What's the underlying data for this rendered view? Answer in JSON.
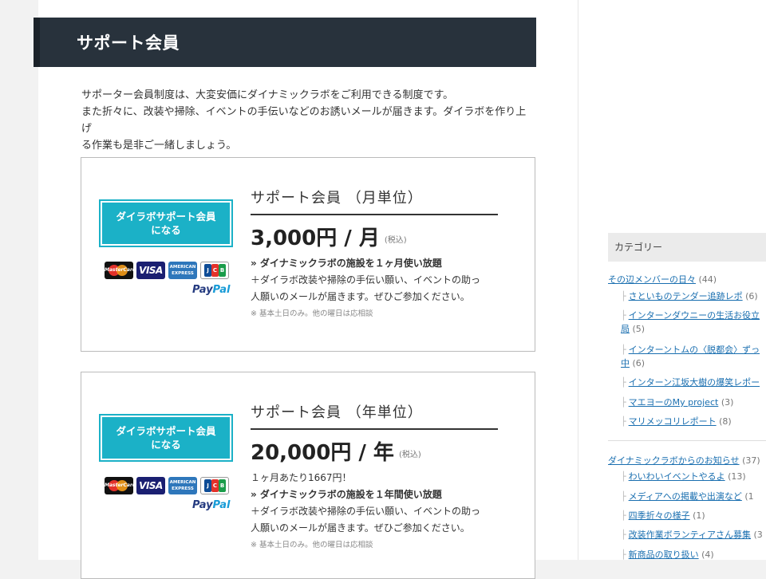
{
  "page_title": "サポート会員",
  "intro": {
    "line1": "サポーター会員制度は、大変安価にダイナミックラボをご利用できる制度です。",
    "line2": "また折々に、改装や掃除、イベントの手伝いなどのお誘いメールが届きます。ダイラボを作り上げ",
    "line3": "る作業も是非ご一緒しましょう。"
  },
  "cards_logos": {
    "mastercard": "MasterCard",
    "visa": "VISA",
    "amex": "AMERICAN EXPRESS",
    "jcb": "JCB",
    "paypal_a": "Pay",
    "paypal_b": "Pal"
  },
  "plans": [
    {
      "button_line1": "ダイラボサポート会員",
      "button_line2": "になる",
      "title": "サポート会員 （月単位）",
      "price": "3,000円 / 月",
      "tax": "(税込)",
      "extra": "",
      "benefit": "» ダイナミックラボの施設を１ヶ月使い放題",
      "desc1": "＋ダイラボ改装や掃除の手伝い願い、イベントの助っ",
      "desc2": "人願いのメールが届きます。ぜひご参加ください。",
      "note": "※ 基本土日のみ。他の曜日は応相談"
    },
    {
      "button_line1": "ダイラボサポート会員",
      "button_line2": "になる",
      "title": "サポート会員 （年単位）",
      "price": "20,000円 / 年",
      "tax": "(税込)",
      "extra": "１ヶ月あたり1667円！",
      "benefit": "» ダイナミックラボの施設を１年間使い放題",
      "desc1": "＋ダイラボ改装や掃除の手伝い願い、イベントの助っ",
      "desc2": "人願いのメールが届きます。ぜひご参加ください。",
      "note": "※ 基本土日のみ。他の曜日は応相談"
    }
  ],
  "sidebar": {
    "category_heading": "カテゴリー",
    "groups": [
      {
        "label": "その辺メンバーの日々",
        "count": "(44)",
        "children": [
          {
            "label": "さといものテンダー追跡レポ",
            "count": "(6)"
          },
          {
            "label": "インターンダウニーの生活お役立",
            "count": ""
          },
          {
            "label": "局",
            "count": "(5)"
          },
          {
            "label": "インターントムの〈脱都会〉ずっ",
            "count": ""
          },
          {
            "label": "中",
            "count": "(6)"
          },
          {
            "label": "インターン江坂大樹の爆笑レポー",
            "count": ""
          },
          {
            "label": "マエヨーのMy project",
            "count": "(3)"
          },
          {
            "label": "マリメッコリレポート",
            "count": "(8)"
          }
        ]
      },
      {
        "label": "ダイナミックラボからのお知らせ",
        "count": "(37)",
        "children": [
          {
            "label": "わいわいイベントやるよ",
            "count": "(13)"
          },
          {
            "label": "メディアへの掲載や出演など",
            "count": "(1"
          },
          {
            "label": "四季折々の様子",
            "count": "(1)"
          },
          {
            "label": "改装作業ボランティアさん募集",
            "count": "(3"
          },
          {
            "label": "新商品の取り扱い",
            "count": "(4)"
          }
        ]
      }
    ]
  }
}
